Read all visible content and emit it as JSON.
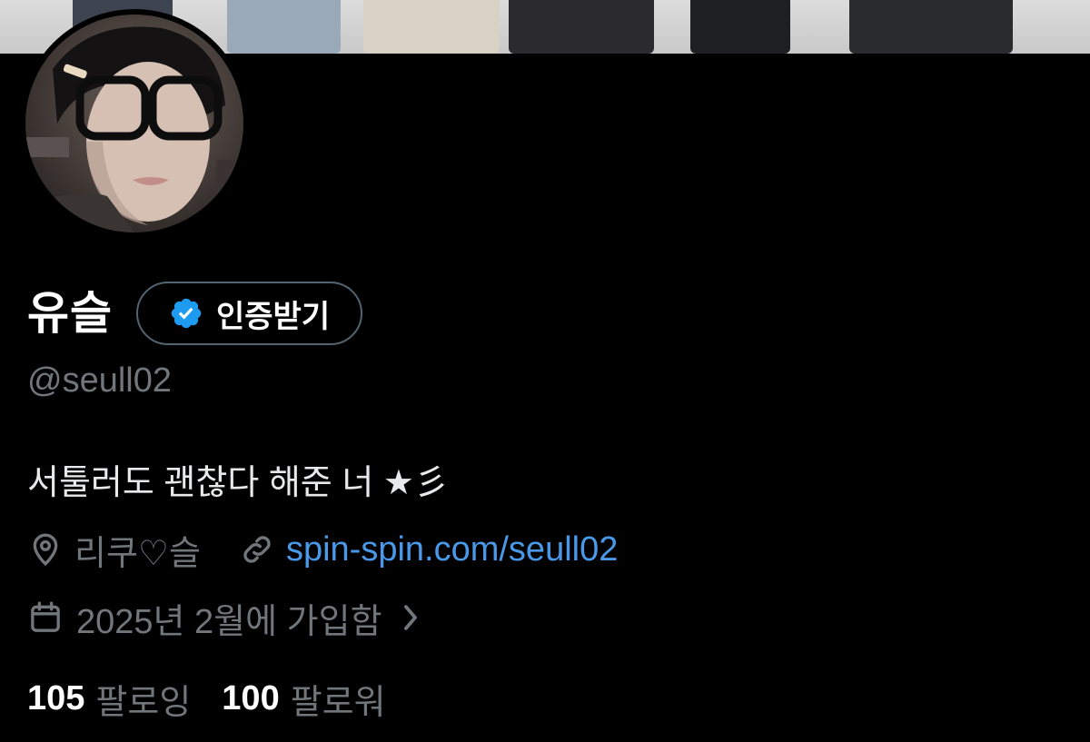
{
  "profile": {
    "display_name": "유슬",
    "handle": "@seull02",
    "bio": "서툴러도 괜찮다 해준 너 ★彡",
    "verify_button_label": "인증받기",
    "location": "리쿠♡슬",
    "website": "spin-spin.com/seull02",
    "joined": "2025년 2월에 가입함",
    "following_count": "105",
    "following_label": "팔로잉",
    "followers_count": "100",
    "followers_label": "팔로워"
  },
  "icons": {
    "verified": "verified-badge-icon",
    "location": "location-pin-icon",
    "link": "link-icon",
    "calendar": "calendar-icon",
    "chevron": "chevron-right-icon"
  },
  "colors": {
    "background": "#000000",
    "link": "#4a99e9",
    "muted": "#71767b",
    "verified": "#1d9bf0",
    "button_border": "#536471"
  }
}
